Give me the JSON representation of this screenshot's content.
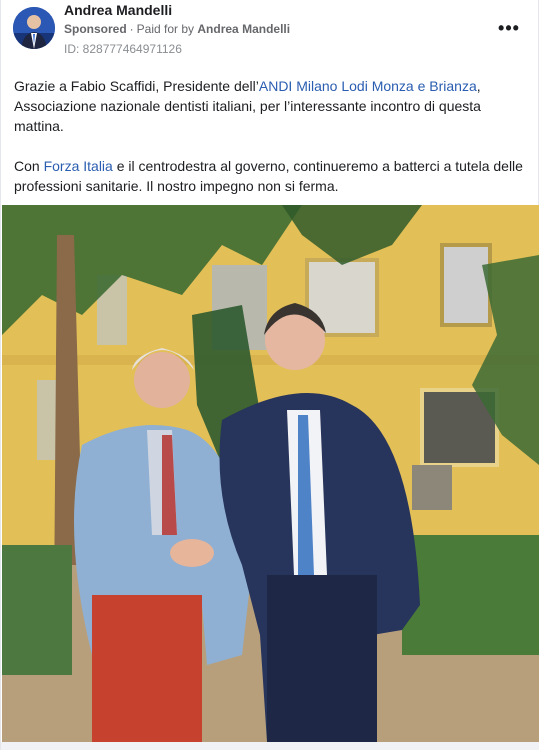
{
  "post": {
    "author": "Andrea Mandelli",
    "sponsored_label": "Sponsored",
    "separator": "·",
    "paid_for_prefix": "Paid for by",
    "paid_for_name": "Andrea Mandelli",
    "id_label": "ID: 828777464971126",
    "more_icon": "more-horizontal-icon",
    "more_symbol": "•••"
  },
  "body": {
    "p1_a": "Grazie a Fabio Scaffidi, Presidente dell’",
    "p1_link": "ANDI Milano Lodi Monza e Brianza",
    "p1_b": ", Associazione nazionale dentisti italiani, per l’interessante incontro di questa mattina.",
    "p2_a": "Con ",
    "p2_link": "Forza Italia",
    "p2_b": " e il centrodestra al governo, continueremo a batterci a tutela delle professioni sanitarie. Il nostro impegno non si ferma."
  },
  "colors": {
    "link": "#2a5db0",
    "meta": "#65676b",
    "text": "#1c1e21"
  }
}
